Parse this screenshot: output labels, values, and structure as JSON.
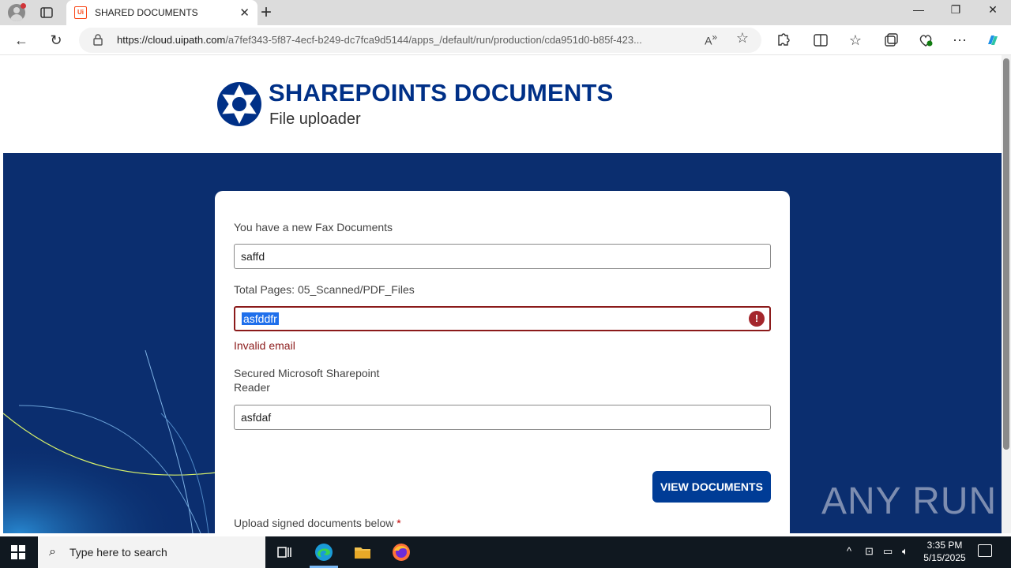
{
  "browser": {
    "tab_title": "SHARED DOCUMENTS",
    "tab_favicon_text": "Ui",
    "url_host": "https://cloud.uipath.com",
    "url_path": "/a7fef343-5f87-4ecf-b249-dc7fca9d5144/apps_/default/run/production/cda951d0-b85f-423...",
    "window_buttons": [
      "—",
      "❐",
      "✕"
    ]
  },
  "header": {
    "title": "SHAREPOINTS DOCUMENTS",
    "subtitle": "File uploader",
    "logo_icon": "aperture-icon",
    "brand_color": "#003087"
  },
  "form": {
    "field1": {
      "label": "You have a new Fax Documents",
      "value": "saffd"
    },
    "field2": {
      "label": "Total Pages: 05_Scanned/PDF_Files",
      "value": "asfddfr",
      "error": "Invalid email",
      "selected": true
    },
    "field3": {
      "label_line1": "Secured Microsoft Sharepoint",
      "label_line2": "Reader",
      "value": "asfdaf"
    },
    "submit_label": "VIEW DOCUMENTS",
    "upload_label": "Upload signed documents below",
    "required_mark": "*",
    "accent_color": "#003c96",
    "error_color": "#8b1a1a"
  },
  "watermark": "ANY RUN",
  "taskbar": {
    "search_placeholder": "Type here to search",
    "time": "3:35 PM",
    "date": "5/15/2025"
  }
}
